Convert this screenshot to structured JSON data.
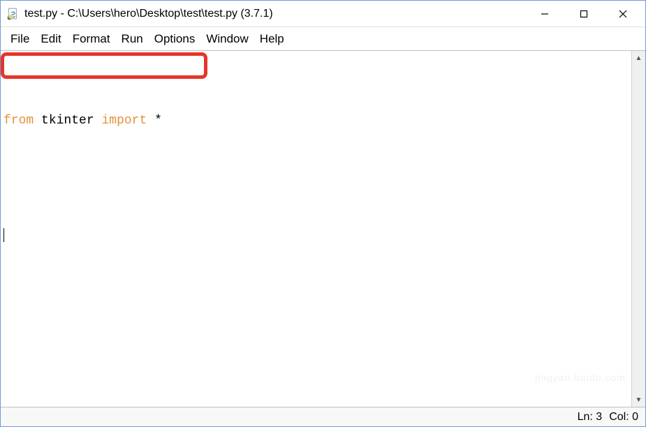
{
  "titlebar": {
    "title": "test.py - C:\\Users\\hero\\Desktop\\test\\test.py (3.7.1)"
  },
  "menu": {
    "items": [
      "File",
      "Edit",
      "Format",
      "Run",
      "Options",
      "Window",
      "Help"
    ]
  },
  "code": {
    "line1": {
      "kw_from": "from",
      "sp1": " ",
      "mod": "tkinter",
      "sp2": " ",
      "kw_import": "import",
      "sp3": " ",
      "star": "*"
    }
  },
  "status": {
    "ln": "Ln: 3",
    "col": "Col: 0"
  },
  "watermark": "jingyan.baidu.com"
}
